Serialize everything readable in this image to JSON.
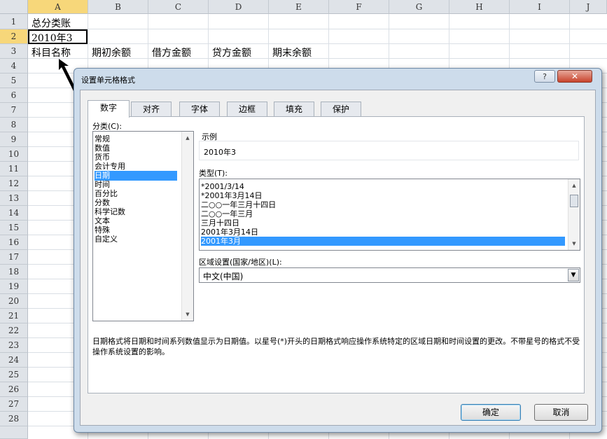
{
  "sheet": {
    "columns": [
      "A",
      "B",
      "C",
      "D",
      "E",
      "F",
      "G",
      "H",
      "I",
      "J"
    ],
    "rows": [
      "1",
      "2",
      "3",
      "4",
      "5",
      "6",
      "7",
      "8",
      "9",
      "10",
      "11",
      "12",
      "13",
      "14",
      "15",
      "16",
      "17",
      "18",
      "19",
      "20",
      "21",
      "22",
      "23",
      "24",
      "25",
      "26",
      "27",
      "28"
    ],
    "cells": {
      "a1": "总分类账",
      "a2": "2010年3",
      "a3": "科目名称",
      "b3": "期初余额",
      "c3": "借方金额",
      "d3": "贷方金额",
      "e3": "期末余额"
    }
  },
  "dialog": {
    "title": "设置单元格格式",
    "help": "?",
    "close": "✕",
    "tabs": [
      "数字",
      "对齐",
      "字体",
      "边框",
      "填充",
      "保护"
    ],
    "category_label": "分类(C):",
    "categories": [
      "常规",
      "数值",
      "货币",
      "会计专用",
      "日期",
      "时间",
      "百分比",
      "分数",
      "科学记数",
      "文本",
      "特殊",
      "自定义"
    ],
    "selected_category": "日期",
    "sample_label": "示例",
    "sample_value": "2010年3",
    "type_label": "类型(T):",
    "types": [
      "*2001/3/14",
      "*2001年3月14日",
      "二○○一年三月十四日",
      "二○○一年三月",
      "三月十四日",
      "2001年3月14日",
      "2001年3月"
    ],
    "selected_type": "2001年3月",
    "locale_label": "区域设置(国家/地区)(L):",
    "locale_value": "中文(中国)",
    "description": "日期格式将日期和时间系列数值显示为日期值。以星号(*)开头的日期格式响应操作系统特定的区域日期和时间设置的更改。不带星号的格式不受操作系统设置的影响。",
    "ok_label": "确定",
    "cancel_label": "取消"
  }
}
